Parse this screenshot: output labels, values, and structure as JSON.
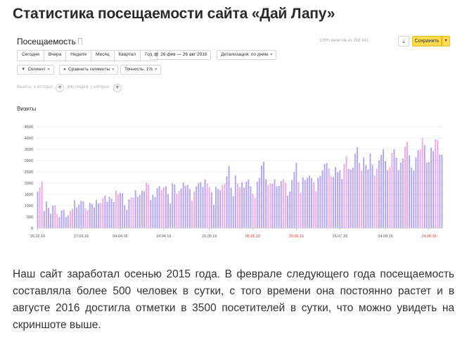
{
  "article": {
    "title": "Статистика посещаемости сайта «Дай Лапу»",
    "body": "Наш сайт заработал осенью 2015 года. В феврале следующего года посещаемость составляла более 500 человек в сутки, с того времени она постоянно растет и в августе 2016 достигла отметки в 3500 посетителей в сутки, что можно увидеть на скриншоте выше."
  },
  "report": {
    "title": "Посещаемость",
    "sample_note": "100% визитов из 358 841",
    "save_label": "Сохранить",
    "period_buttons": [
      "Сегодня",
      "Вчера",
      "Неделя",
      "Месяц",
      "Квартал",
      "Год"
    ],
    "date_range": "26 фев — 26 авг 2016",
    "detail": "Детализация: по дням",
    "segment": "Сегмент",
    "compare": "Сравнить сегменты",
    "accuracy": "Точность: 1%",
    "filter_visits": "Визиты, в которых",
    "filter_users": "для людей, у которых",
    "metric": "Визиты"
  },
  "chart_data": {
    "type": "bar",
    "title": "",
    "ylabel": "Визиты",
    "ylim": [
      0,
      4500
    ],
    "yticks": [
      0,
      500,
      1000,
      1500,
      2000,
      2500,
      3000,
      3500,
      4000,
      4500
    ],
    "grid": true,
    "x_tick_labels": [
      {
        "index": 0,
        "label": "26.02.16",
        "weekend": false
      },
      {
        "index": 20,
        "label": "17.03.16",
        "weekend": false
      },
      {
        "index": 38,
        "label": "04.04.16",
        "weekend": false
      },
      {
        "index": 58,
        "label": "24.04.16",
        "weekend": false
      },
      {
        "index": 79,
        "label": "15.05.16",
        "weekend": false
      },
      {
        "index": 99,
        "label": "05.06.16",
        "weekend": true
      },
      {
        "index": 119,
        "label": "25.06.16",
        "weekend": true
      },
      {
        "index": 139,
        "label": "15.07.16",
        "weekend": false
      },
      {
        "index": 160,
        "label": "04.08.16",
        "weekend": false
      },
      {
        "index": 180,
        "label": "24.08.16",
        "weekend": true
      }
    ],
    "start_weekday": 4,
    "values": [
      1620,
      1820,
      2080,
      760,
      1180,
      900,
      640,
      990,
      1020,
      640,
      480,
      790,
      820,
      490,
      570,
      760,
      860,
      1240,
      920,
      1050,
      1220,
      1190,
      880,
      790,
      1130,
      1080,
      920,
      1260,
      1090,
      1120,
      1330,
      1450,
      1170,
      1400,
      1310,
      1160,
      1680,
      1500,
      1560,
      1550,
      1020,
      820,
      1280,
      1370,
      1350,
      1680,
      1400,
      1470,
      1660,
      1640,
      2020,
      1950,
      1260,
      1470,
      1380,
      1780,
      1870,
      1700,
      1810,
      1850,
      1510,
      1100,
      1990,
      1930,
      1530,
      1650,
      1760,
      2030,
      1880,
      1920,
      1740,
      1230,
      1620,
      1860,
      2010,
      2040,
      1830,
      2160,
      1970,
      1810,
      1590,
      1030,
      1830,
      1740,
      1690,
      1900,
      1960,
      2300,
      2760,
      1800,
      1420,
      2340,
      1980,
      1820,
      2040,
      1800,
      2070,
      2160,
      1850,
      1520,
      1330,
      2070,
      2240,
      2780,
      2950,
      2170,
      1910,
      1990,
      1970,
      2170,
      1850,
      1880,
      2100,
      2180,
      2030,
      1440,
      1630,
      2140,
      2500,
      2900,
      2050,
      1580,
      2260,
      2130,
      2240,
      2330,
      2220,
      2040,
      1640,
      2240,
      2320,
      2570,
      2850,
      2890,
      2650,
      2300,
      2280,
      2710,
      2480,
      2560,
      2190,
      2840,
      3180,
      2640,
      2600,
      2680,
      3310,
      3590,
      2900,
      2560,
      3140,
      2800,
      2600,
      3310,
      2820,
      2330,
      2640,
      3000,
      3250,
      3500,
      2970,
      2580,
      2710,
      3340,
      3500,
      3140,
      2580,
      2910,
      3090,
      3610,
      3820,
      3240,
      2680,
      2560,
      3140,
      3460,
      3480,
      4000,
      3680,
      2910,
      2930,
      3570,
      3420,
      3940,
      3900,
      3270,
      3260
    ],
    "colors": {
      "weekday": "#b3a4ec",
      "weekend": "#eda9e6"
    }
  }
}
